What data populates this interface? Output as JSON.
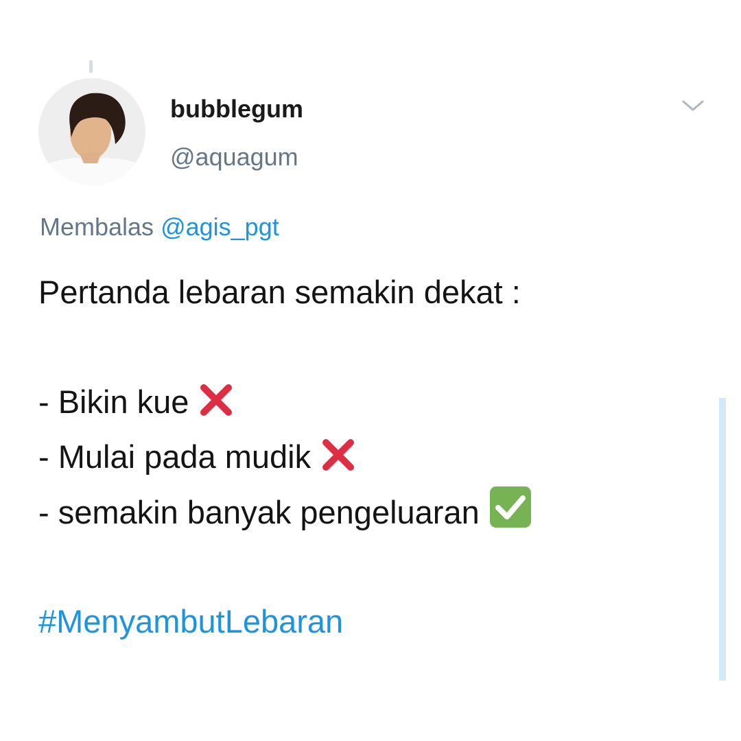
{
  "tweet": {
    "display_name": "bubblegum",
    "handle": "@aquagum",
    "reply_prefix": "Membalas",
    "reply_to": "@agis_pgt",
    "title_line": "Pertanda lebaran semakin dekat :",
    "list_items": [
      {
        "text": "- Bikin kue",
        "status_icon": "cross-mark-icon"
      },
      {
        "text": "- Mulai pada mudik",
        "status_icon": "cross-mark-icon"
      },
      {
        "text": "- semakin banyak pengeluaran",
        "status_icon": "check-mark-button-icon"
      }
    ],
    "hashtag": "#MenyambutLebaran"
  },
  "colors": {
    "link_blue": "#1b95e0",
    "secondary_text": "#657786",
    "cross_red": "#dd2e44",
    "check_green": "#77b255"
  }
}
